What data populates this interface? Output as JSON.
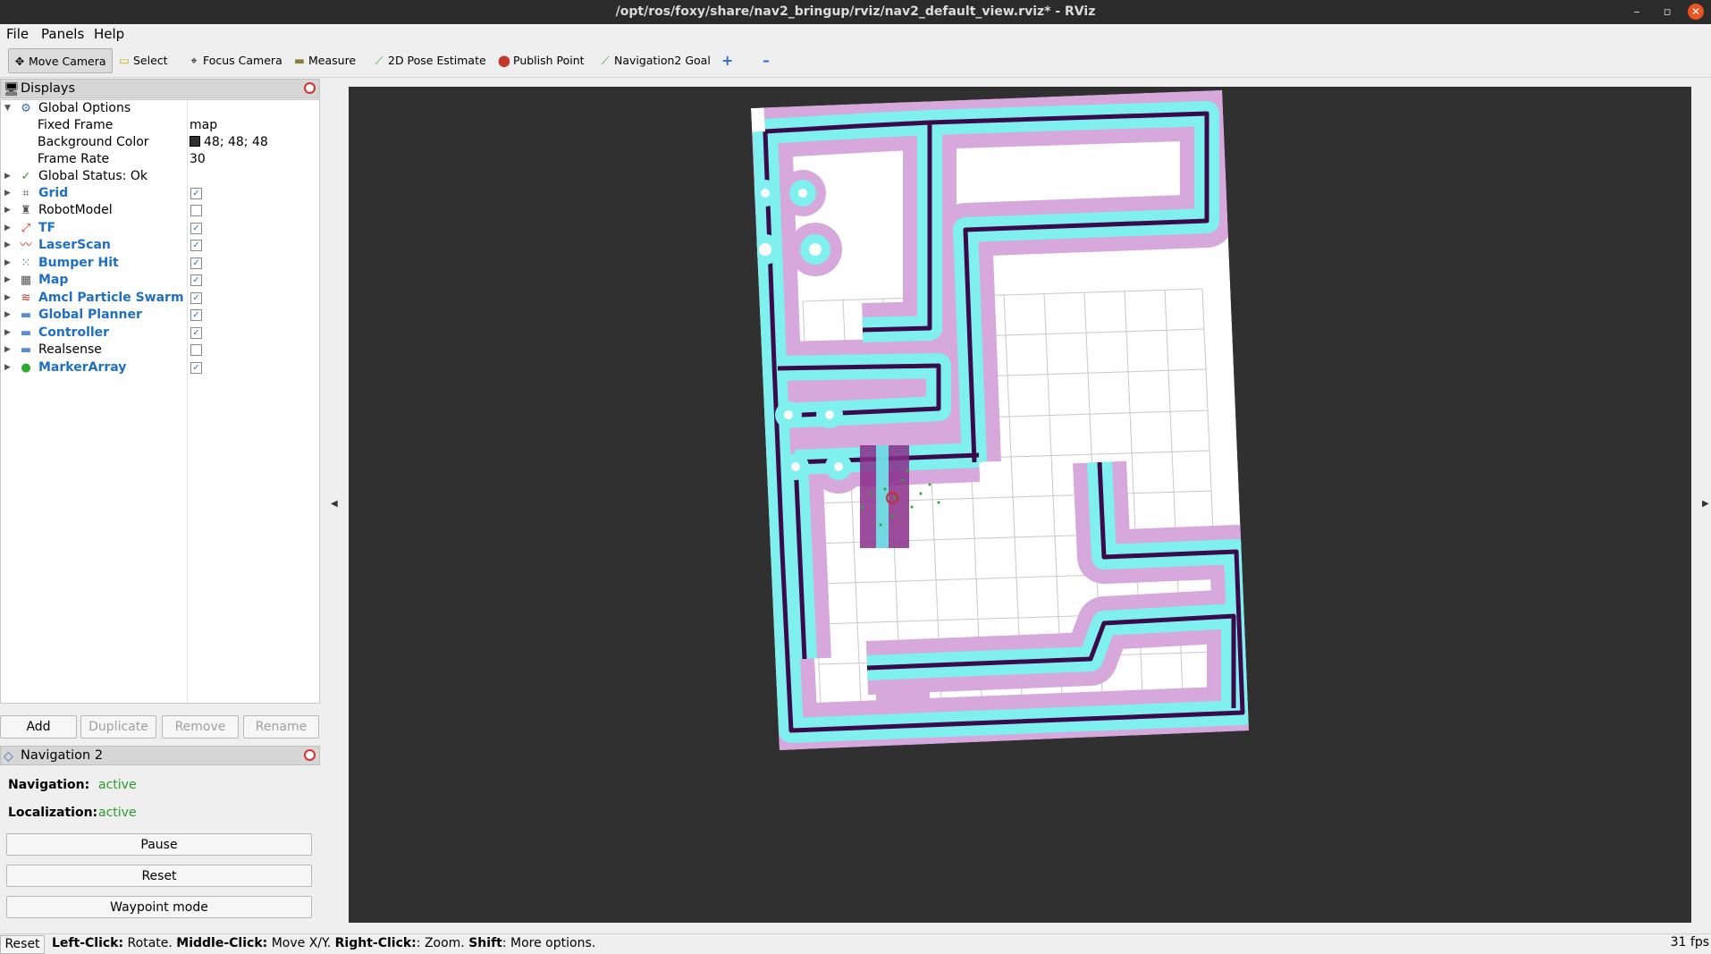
{
  "window": {
    "title": "/opt/ros/foxy/share/nav2_bringup/rviz/nav2_default_view.rviz* - RViz",
    "controls": {
      "minimize": "–",
      "maximize": "▫",
      "close": "✕"
    }
  },
  "menu": {
    "file": "File",
    "panels": "Panels",
    "help": "Help"
  },
  "toolbar": {
    "move_camera": "Move Camera",
    "select": "Select",
    "focus_camera": "Focus Camera",
    "measure": "Measure",
    "pose_estimate": "2D Pose Estimate",
    "publish_point": "Publish Point",
    "nav_goal": "Navigation2 Goal",
    "add_tool": "+",
    "remove_tool": "–"
  },
  "displays_panel": {
    "title": "Displays",
    "global_options": {
      "label": "Global Options",
      "fixed_frame_label": "Fixed Frame",
      "fixed_frame_value": "map",
      "background_color_label": "Background Color",
      "background_color_value": "48; 48; 48",
      "frame_rate_label": "Frame Rate",
      "frame_rate_value": "30"
    },
    "global_status": "Global Status: Ok",
    "items": [
      {
        "label": "Grid",
        "enabled": true,
        "icon": "grid-icon"
      },
      {
        "label": "RobotModel",
        "enabled": false,
        "icon": "robot-icon"
      },
      {
        "label": "TF",
        "enabled": true,
        "icon": "tf-icon"
      },
      {
        "label": "LaserScan",
        "enabled": true,
        "icon": "laser-icon"
      },
      {
        "label": "Bumper Hit",
        "enabled": true,
        "icon": "points-icon"
      },
      {
        "label": "Map",
        "enabled": true,
        "icon": "map-icon"
      },
      {
        "label": "Amcl Particle Swarm",
        "enabled": true,
        "icon": "particles-icon"
      },
      {
        "label": "Global Planner",
        "enabled": true,
        "icon": "folder-icon"
      },
      {
        "label": "Controller",
        "enabled": true,
        "icon": "folder-icon"
      },
      {
        "label": "Realsense",
        "enabled": false,
        "icon": "folder-icon"
      },
      {
        "label": "MarkerArray",
        "enabled": true,
        "icon": "marker-icon"
      }
    ],
    "buttons": {
      "add": "Add",
      "duplicate": "Duplicate",
      "remove": "Remove",
      "rename": "Rename"
    }
  },
  "nav_panel": {
    "title": "Navigation 2",
    "navigation_label": "Navigation:",
    "navigation_value": "active",
    "localization_label": "Localization:",
    "localization_value": "active",
    "pause": "Pause",
    "reset": "Reset",
    "waypoint": "Waypoint mode"
  },
  "status": {
    "reset": "Reset",
    "left_click": "Left-Click:",
    "left_action": " Rotate. ",
    "middle_click": "Middle-Click:",
    "middle_action": " Move X/Y. ",
    "right_click": "Right-Click:",
    "right_action": ": Zoom. ",
    "shift": "Shift",
    "shift_action": ": More options.",
    "fps": "31 fps"
  },
  "colors": {
    "background": "#303030",
    "inflation": "#d6a8dc",
    "inscribed": "#7ff0ee",
    "obstacle": "#3a0a4a"
  }
}
